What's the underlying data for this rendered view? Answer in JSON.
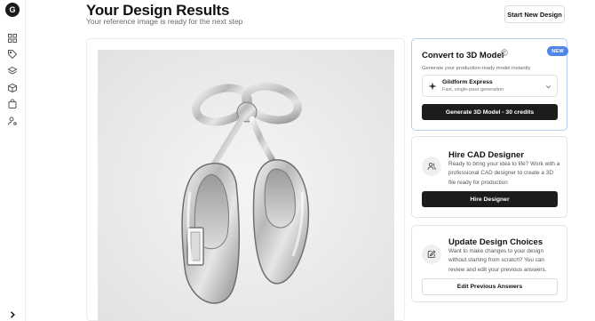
{
  "sidebar": {
    "logo_letter": "G",
    "icons": [
      "grid-icon",
      "tag-icon",
      "layers-icon",
      "box-icon",
      "bag-icon",
      "user-settings-icon"
    ],
    "expand_icon": "chevron-right-icon"
  },
  "header": {
    "title": "Your Design Results",
    "subtitle": "Your reference image is ready for the next step",
    "start_button": "Start New Design"
  },
  "preview": {
    "image_alt": "Silver ballet shoes pendant with bow"
  },
  "convert_card": {
    "badge": "NEW",
    "title": "Convert to 3D Model",
    "description": "Generate your production-ready model instantly",
    "model": {
      "name": "Gildform Express",
      "subtitle": "Fast, single-pass generation"
    },
    "button": "Generate 3D Model - 30 credits"
  },
  "cad_card": {
    "title": "Hire CAD Designer",
    "body": "Ready to bring your idea to life? Work with a professional CAD designer to create a 3D file ready for production",
    "button": "Hire Designer"
  },
  "update_card": {
    "title": "Update Design Choices",
    "body": "Want to make changes to your design without starting from scratch? You can review and edit your previous answers.",
    "button": "Edit Previous Answers"
  },
  "colors": {
    "accent_blue": "#4f86ea",
    "card_border_active": "#b9cdf2",
    "button_dark": "#1c1c1c",
    "image_bg": "#e9e9e9"
  }
}
